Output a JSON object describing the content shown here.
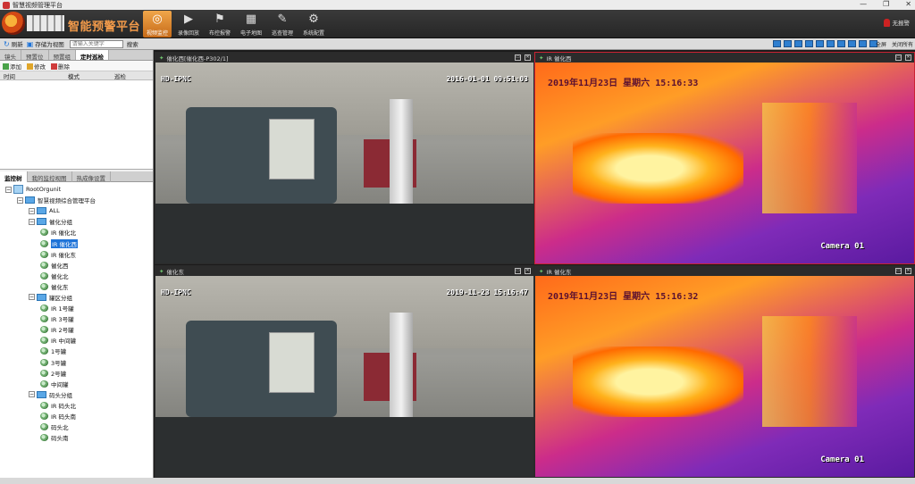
{
  "window": {
    "title": "智慧视频管理平台"
  },
  "brand": {
    "name": "智能预警平台"
  },
  "modules": [
    {
      "label": "视频监控",
      "icon": "camera-lens-icon",
      "glyph": "◎"
    },
    {
      "label": "录像回放",
      "icon": "film-icon",
      "glyph": "▶"
    },
    {
      "label": "布控报警",
      "icon": "alarm-icon",
      "glyph": "⚑"
    },
    {
      "label": "电子地图",
      "icon": "map-icon",
      "glyph": "▦"
    },
    {
      "label": "巡查管理",
      "icon": "patrol-icon",
      "glyph": "✎"
    },
    {
      "label": "系统配置",
      "icon": "gear-icon",
      "glyph": "⚙"
    }
  ],
  "alarm": {
    "label": "无报警",
    "icon": "siren-icon"
  },
  "toolbar": {
    "refresh_label": "刷新",
    "save_view_label": "存储为视图",
    "search_placeholder": "请输入关键字",
    "search_label": "搜索",
    "fullscreen_label": "全屏",
    "close_all_label": "关闭所有"
  },
  "left_tabs": [
    "镜头",
    "预置位",
    "预置组",
    "定时巡检"
  ],
  "actions": {
    "add": "添加",
    "edit": "修改",
    "delete": "删除"
  },
  "table_headers": [
    "时间",
    "模式",
    "巡检"
  ],
  "tree_tabs": [
    "监控树",
    "我的监控视图",
    "热成像设置"
  ],
  "tree": [
    {
      "label": "RootOrgunit",
      "depth": 0,
      "kind": "root"
    },
    {
      "label": "智慧视频综合管理平台",
      "depth": 1,
      "kind": "folder"
    },
    {
      "label": "ALL",
      "depth": 2,
      "kind": "folder"
    },
    {
      "label": "催化分组",
      "depth": 2,
      "kind": "folder"
    },
    {
      "label": "IR 催化北",
      "depth": 3,
      "kind": "cam"
    },
    {
      "label": "IR 催化西",
      "depth": 3,
      "kind": "cam",
      "selected": true
    },
    {
      "label": "IR 催化东",
      "depth": 3,
      "kind": "cam"
    },
    {
      "label": "催化西",
      "depth": 3,
      "kind": "cam"
    },
    {
      "label": "催化北",
      "depth": 3,
      "kind": "cam"
    },
    {
      "label": "催化东",
      "depth": 3,
      "kind": "cam"
    },
    {
      "label": "罐区分组",
      "depth": 2,
      "kind": "folder"
    },
    {
      "label": "IR 1号罐",
      "depth": 3,
      "kind": "cam"
    },
    {
      "label": "IR 3号罐",
      "depth": 3,
      "kind": "cam"
    },
    {
      "label": "IR 2号罐",
      "depth": 3,
      "kind": "cam"
    },
    {
      "label": "IR 中间罐",
      "depth": 3,
      "kind": "cam"
    },
    {
      "label": "1号罐",
      "depth": 3,
      "kind": "cam"
    },
    {
      "label": "3号罐",
      "depth": 3,
      "kind": "cam"
    },
    {
      "label": "2号罐",
      "depth": 3,
      "kind": "cam"
    },
    {
      "label": "中间罐",
      "depth": 3,
      "kind": "cam"
    },
    {
      "label": "码头分组",
      "depth": 2,
      "kind": "folder"
    },
    {
      "label": "IR 码头北",
      "depth": 3,
      "kind": "cam"
    },
    {
      "label": "IR 码头南",
      "depth": 3,
      "kind": "cam"
    },
    {
      "label": "码头北",
      "depth": 3,
      "kind": "cam"
    },
    {
      "label": "码头南",
      "depth": 3,
      "kind": "cam"
    }
  ],
  "videos": [
    {
      "title": "催化西[催化西-P302/1]",
      "osd_name": "HD-IPNC",
      "osd_time": "2016-01-01 09:51:03",
      "type": "rgb"
    },
    {
      "title": "IR 催化西",
      "osd_time": "2019年11月23日  星期六  15:16:33",
      "osd_name": "Camera 01",
      "type": "ir"
    },
    {
      "title": "催化东",
      "osd_name": "HD-IPNC",
      "osd_time": "2019-11-23 15:16:47",
      "type": "rgb"
    },
    {
      "title": "IR 催化东",
      "osd_time": "2019年11月23日  星期六  15:16:32",
      "osd_name": "Camera 01",
      "type": "ir"
    }
  ],
  "colors": {
    "accent": "#f29a4a",
    "selected": "#1e73d8",
    "panel_bg": "#f0f0f0"
  }
}
